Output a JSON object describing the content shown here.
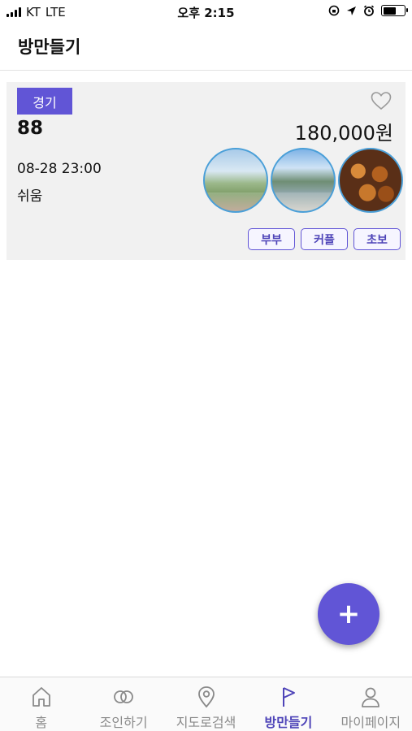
{
  "status_bar": {
    "carrier": "KT",
    "network": "LTE",
    "time": "오후 2:15",
    "battery_level": 0.6
  },
  "header": {
    "title": "방만들기"
  },
  "room_card": {
    "category": "경기",
    "name": "88",
    "price": "180,000원",
    "date": "08-28 23:00",
    "level": "쉬움",
    "favorite": false,
    "photos": [
      "golf-course-photo",
      "resort-pool-photo",
      "fried-chicken-photo"
    ],
    "tags": [
      "부부",
      "커플",
      "초보"
    ]
  },
  "fab": {
    "label": "+"
  },
  "bottom_nav": {
    "items": [
      {
        "label": "홈",
        "icon": "home-icon"
      },
      {
        "label": "조인하기",
        "icon": "rings-icon"
      },
      {
        "label": "지도로검색",
        "icon": "map-pin-icon"
      },
      {
        "label": "방만들기",
        "icon": "flag-icon",
        "active": true
      },
      {
        "label": "마이페이지",
        "icon": "user-icon"
      }
    ]
  },
  "colors": {
    "accent": "#6155d6",
    "card_bg": "#f1f1f1",
    "photo_border": "#4a9fd8",
    "inactive": "#8a8a8a"
  }
}
